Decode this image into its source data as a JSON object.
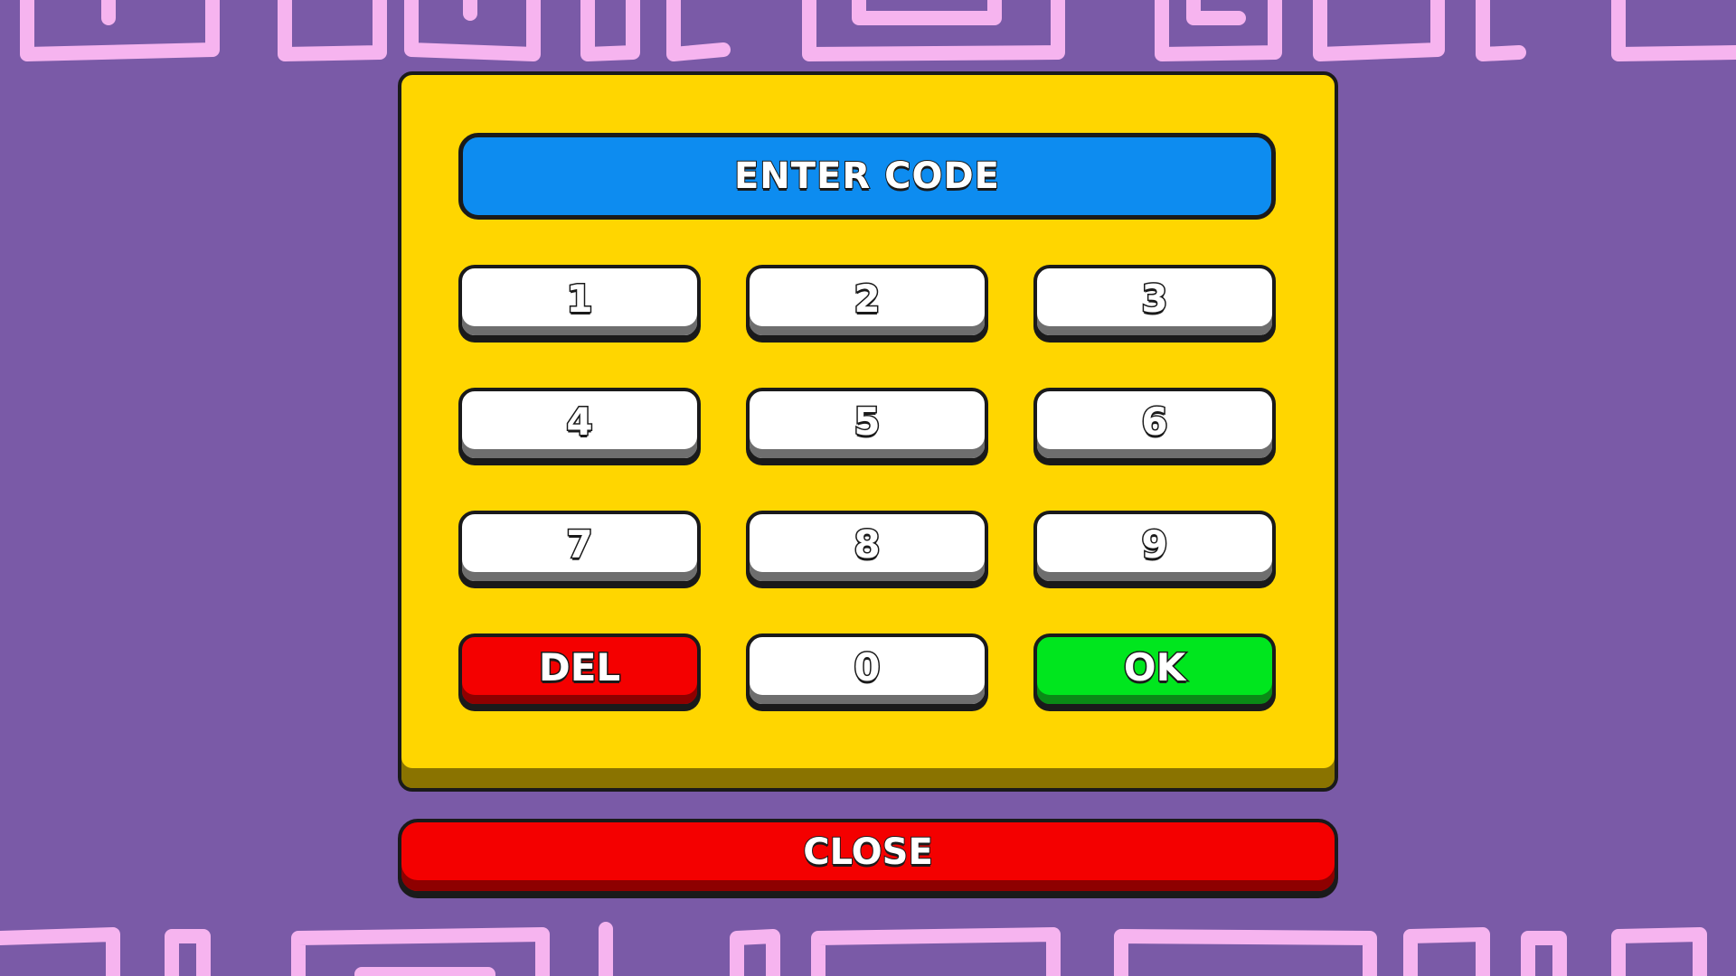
{
  "dialog": {
    "title": "ENTER CODE",
    "keys": [
      {
        "label": "1",
        "role": "digit"
      },
      {
        "label": "2",
        "role": "digit"
      },
      {
        "label": "3",
        "role": "digit"
      },
      {
        "label": "4",
        "role": "digit"
      },
      {
        "label": "5",
        "role": "digit"
      },
      {
        "label": "6",
        "role": "digit"
      },
      {
        "label": "7",
        "role": "digit"
      },
      {
        "label": "8",
        "role": "digit"
      },
      {
        "label": "9",
        "role": "digit"
      },
      {
        "label": "DEL",
        "role": "delete"
      },
      {
        "label": "0",
        "role": "digit"
      },
      {
        "label": "OK",
        "role": "confirm"
      }
    ],
    "close_label": "CLOSE"
  },
  "colors": {
    "background": "#7a5aa7",
    "doodle": "#f6b4ef",
    "panel": "#ffd600",
    "title_bar": "#0d8cf0",
    "key": "#ffffff",
    "delete": "#f40000",
    "confirm": "#00e61e",
    "close": "#f40000"
  }
}
